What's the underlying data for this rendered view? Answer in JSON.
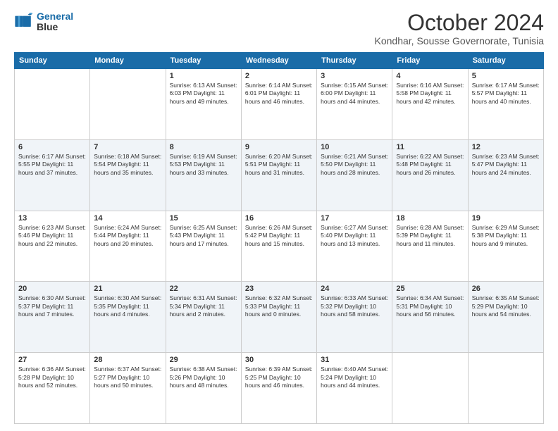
{
  "header": {
    "logo_line1": "General",
    "logo_line2": "Blue",
    "month": "October 2024",
    "location": "Kondhar, Sousse Governorate, Tunisia"
  },
  "days_of_week": [
    "Sunday",
    "Monday",
    "Tuesday",
    "Wednesday",
    "Thursday",
    "Friday",
    "Saturday"
  ],
  "weeks": [
    [
      {
        "day": "",
        "info": ""
      },
      {
        "day": "",
        "info": ""
      },
      {
        "day": "1",
        "info": "Sunrise: 6:13 AM\nSunset: 6:03 PM\nDaylight: 11 hours and 49 minutes."
      },
      {
        "day": "2",
        "info": "Sunrise: 6:14 AM\nSunset: 6:01 PM\nDaylight: 11 hours and 46 minutes."
      },
      {
        "day": "3",
        "info": "Sunrise: 6:15 AM\nSunset: 6:00 PM\nDaylight: 11 hours and 44 minutes."
      },
      {
        "day": "4",
        "info": "Sunrise: 6:16 AM\nSunset: 5:58 PM\nDaylight: 11 hours and 42 minutes."
      },
      {
        "day": "5",
        "info": "Sunrise: 6:17 AM\nSunset: 5:57 PM\nDaylight: 11 hours and 40 minutes."
      }
    ],
    [
      {
        "day": "6",
        "info": "Sunrise: 6:17 AM\nSunset: 5:55 PM\nDaylight: 11 hours and 37 minutes."
      },
      {
        "day": "7",
        "info": "Sunrise: 6:18 AM\nSunset: 5:54 PM\nDaylight: 11 hours and 35 minutes."
      },
      {
        "day": "8",
        "info": "Sunrise: 6:19 AM\nSunset: 5:53 PM\nDaylight: 11 hours and 33 minutes."
      },
      {
        "day": "9",
        "info": "Sunrise: 6:20 AM\nSunset: 5:51 PM\nDaylight: 11 hours and 31 minutes."
      },
      {
        "day": "10",
        "info": "Sunrise: 6:21 AM\nSunset: 5:50 PM\nDaylight: 11 hours and 28 minutes."
      },
      {
        "day": "11",
        "info": "Sunrise: 6:22 AM\nSunset: 5:48 PM\nDaylight: 11 hours and 26 minutes."
      },
      {
        "day": "12",
        "info": "Sunrise: 6:23 AM\nSunset: 5:47 PM\nDaylight: 11 hours and 24 minutes."
      }
    ],
    [
      {
        "day": "13",
        "info": "Sunrise: 6:23 AM\nSunset: 5:46 PM\nDaylight: 11 hours and 22 minutes."
      },
      {
        "day": "14",
        "info": "Sunrise: 6:24 AM\nSunset: 5:44 PM\nDaylight: 11 hours and 20 minutes."
      },
      {
        "day": "15",
        "info": "Sunrise: 6:25 AM\nSunset: 5:43 PM\nDaylight: 11 hours and 17 minutes."
      },
      {
        "day": "16",
        "info": "Sunrise: 6:26 AM\nSunset: 5:42 PM\nDaylight: 11 hours and 15 minutes."
      },
      {
        "day": "17",
        "info": "Sunrise: 6:27 AM\nSunset: 5:40 PM\nDaylight: 11 hours and 13 minutes."
      },
      {
        "day": "18",
        "info": "Sunrise: 6:28 AM\nSunset: 5:39 PM\nDaylight: 11 hours and 11 minutes."
      },
      {
        "day": "19",
        "info": "Sunrise: 6:29 AM\nSunset: 5:38 PM\nDaylight: 11 hours and 9 minutes."
      }
    ],
    [
      {
        "day": "20",
        "info": "Sunrise: 6:30 AM\nSunset: 5:37 PM\nDaylight: 11 hours and 7 minutes."
      },
      {
        "day": "21",
        "info": "Sunrise: 6:30 AM\nSunset: 5:35 PM\nDaylight: 11 hours and 4 minutes."
      },
      {
        "day": "22",
        "info": "Sunrise: 6:31 AM\nSunset: 5:34 PM\nDaylight: 11 hours and 2 minutes."
      },
      {
        "day": "23",
        "info": "Sunrise: 6:32 AM\nSunset: 5:33 PM\nDaylight: 11 hours and 0 minutes."
      },
      {
        "day": "24",
        "info": "Sunrise: 6:33 AM\nSunset: 5:32 PM\nDaylight: 10 hours and 58 minutes."
      },
      {
        "day": "25",
        "info": "Sunrise: 6:34 AM\nSunset: 5:31 PM\nDaylight: 10 hours and 56 minutes."
      },
      {
        "day": "26",
        "info": "Sunrise: 6:35 AM\nSunset: 5:29 PM\nDaylight: 10 hours and 54 minutes."
      }
    ],
    [
      {
        "day": "27",
        "info": "Sunrise: 6:36 AM\nSunset: 5:28 PM\nDaylight: 10 hours and 52 minutes."
      },
      {
        "day": "28",
        "info": "Sunrise: 6:37 AM\nSunset: 5:27 PM\nDaylight: 10 hours and 50 minutes."
      },
      {
        "day": "29",
        "info": "Sunrise: 6:38 AM\nSunset: 5:26 PM\nDaylight: 10 hours and 48 minutes."
      },
      {
        "day": "30",
        "info": "Sunrise: 6:39 AM\nSunset: 5:25 PM\nDaylight: 10 hours and 46 minutes."
      },
      {
        "day": "31",
        "info": "Sunrise: 6:40 AM\nSunset: 5:24 PM\nDaylight: 10 hours and 44 minutes."
      },
      {
        "day": "",
        "info": ""
      },
      {
        "day": "",
        "info": ""
      }
    ]
  ]
}
